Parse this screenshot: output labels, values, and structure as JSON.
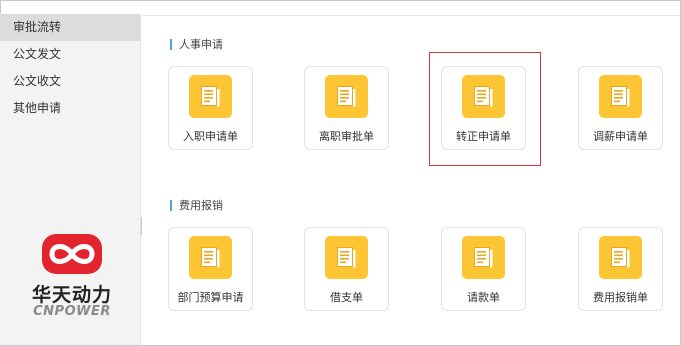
{
  "sidebar": {
    "items": [
      {
        "label": "审批流转",
        "active": true
      },
      {
        "label": "公文发文",
        "active": false
      },
      {
        "label": "公文收文",
        "active": false
      },
      {
        "label": "其他申请",
        "active": false
      }
    ],
    "collapse_glyph": "<"
  },
  "logo": {
    "name": "华天动力",
    "sub": "CNPOWER",
    "color": "#e3232d"
  },
  "sections": [
    {
      "title": "人事申请",
      "cards": [
        {
          "label": "入职申请单",
          "icon": "document-icon"
        },
        {
          "label": "离职审批单",
          "icon": "document-icon"
        },
        {
          "label": "转正申请单",
          "icon": "document-icon",
          "highlighted": true
        },
        {
          "label": "调薪申请单",
          "icon": "document-icon"
        }
      ]
    },
    {
      "title": "费用报销",
      "cards": [
        {
          "label": "部门预算申请",
          "icon": "document-icon"
        },
        {
          "label": "借支单",
          "icon": "document-icon"
        },
        {
          "label": "请款单",
          "icon": "document-icon"
        },
        {
          "label": "费用报销单",
          "icon": "document-icon"
        }
      ]
    }
  ],
  "colors": {
    "icon_bg": "#fdc533",
    "accent_bar": "#4aa7d9",
    "highlight_border": "#d9363e",
    "sidebar_active": "#dcdcdc"
  }
}
